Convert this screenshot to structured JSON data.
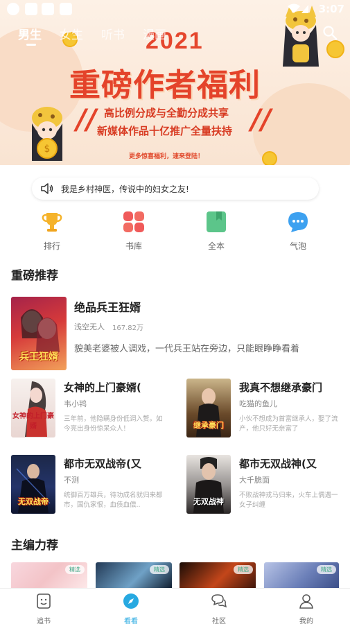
{
  "status_bar": {
    "time": "3:07"
  },
  "top_tabs": [
    {
      "label": "男生",
      "active": true
    },
    {
      "label": "女生",
      "active": false
    },
    {
      "label": "听书",
      "active": false
    },
    {
      "label": "漫画",
      "active": false
    }
  ],
  "banner": {
    "year": "2021",
    "title": "重磅作者福利",
    "line1": "高比例分成与全勤分成共享",
    "line2": "新媒体作品十亿推广全量扶持",
    "footer": "更多惊喜福利，速来登陆！"
  },
  "notice": {
    "text": "我是乡村神医，传说中的妇女之友!"
  },
  "quick_entries": [
    {
      "label": "排行",
      "icon": "trophy-icon"
    },
    {
      "label": "书库",
      "icon": "grid-icon"
    },
    {
      "label": "全本",
      "icon": "bookmark-icon"
    },
    {
      "label": "气泡",
      "icon": "chat-bubble-icon"
    }
  ],
  "section_recommend": {
    "title": "重磅推荐"
  },
  "featured": {
    "title": "绝品兵王狂婿",
    "author": "浅空无人",
    "count": "167.82万",
    "description": "貌美老婆被人调戏，一代兵王站在旁边，只能眼睁睁看着",
    "cover_text": "兵王狂婿"
  },
  "grid_books": [
    {
      "title": "女神的上门豪婿(",
      "author": "韦小鸨",
      "description": "三年前，他隐瞒身份低调入赘。如今亮出身份惊呆众人！",
      "cover_text": "女神的上门豪婿"
    },
    {
      "title": "我真不想继承豪门",
      "author": "吃猫的鱼儿",
      "description": "小伙不想成为首富继承人，娶了流产，他只好无奈富了",
      "cover_text": "继承豪门"
    },
    {
      "title": "都市无双战帝(又",
      "author": "不测",
      "description": "统御百万雄兵，待功成名就归来都市，国仇家恨，血债血偿..",
      "cover_text": "无双战帝"
    },
    {
      "title": "都市无双战神(又",
      "author": "大千脆面",
      "description": "不败战神戎马归来，火车上偶遇一女子纠缠",
      "cover_text": "无双战神"
    }
  ],
  "section_editor": {
    "title": "主编力荐"
  },
  "editor_strip": [
    {
      "tag": "精选"
    },
    {
      "tag": "精选"
    },
    {
      "tag": "精选"
    },
    {
      "tag": "精选"
    }
  ],
  "bottom_nav": [
    {
      "label": "追书",
      "active": false
    },
    {
      "label": "看看",
      "active": true
    },
    {
      "label": "社区",
      "active": false
    },
    {
      "label": "我的",
      "active": false
    }
  ],
  "colors": {
    "accent": "#27a9e1",
    "banner_red": "#e4432a"
  }
}
